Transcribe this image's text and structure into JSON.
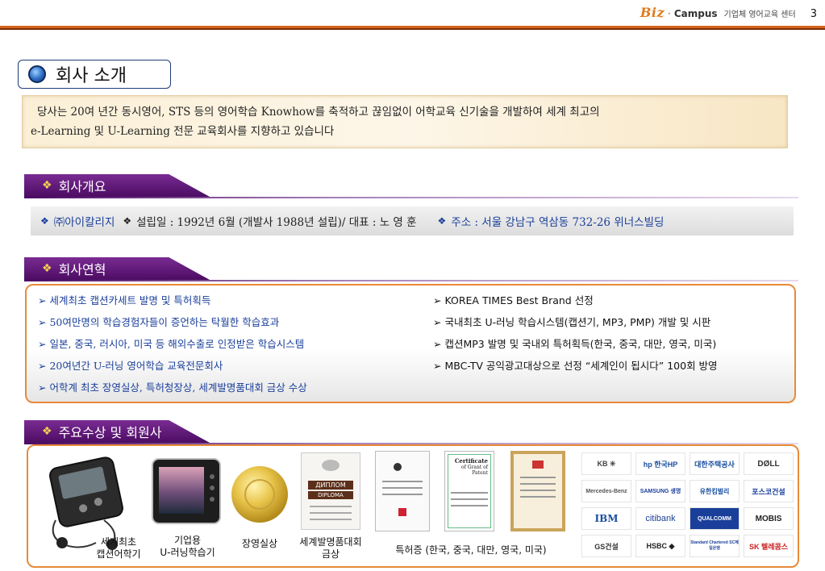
{
  "header": {
    "brand_biz": "Biz",
    "brand_dot": "·",
    "brand_campus": "Campus",
    "brand_sub": "기업체 영어교육 센터",
    "page_number": "3",
    "accent_color": "#d6621b"
  },
  "title": {
    "text": "회사 소개",
    "icon": "blue-orb-bullet-icon"
  },
  "intro": {
    "line1": "당사는 20여 년간 동시영어, STS 등의 영어학습 Knowhow를 축적하고  끊임없이 어학교육 신기술을 개발하여 세계 최고의",
    "line2": "e-Learning 및 U-Learning 전문 교육회사를 지향하고 있습니다"
  },
  "sections": {
    "overview_title": "회사개요",
    "history_title": "회사연혁",
    "awards_title": "주요수상 및 회원사",
    "bullet": "❖",
    "header_color": "#4c0c63"
  },
  "overview": {
    "company": "㈜아이칼리지",
    "established": "설립일 : 1992년 6월 (개발사 1988년 설립)/  대표 : 노 영 훈",
    "address": "주소 : 서울 강남구 역삼동 732-26 위너스빌딩"
  },
  "history": {
    "arrow": "➢",
    "left": [
      "세계최초 캡션카세트 발명 및 특허획득",
      "50여만명의 학습경험자들이 증언하는 탁월한 학습효과",
      "일본, 중국, 러시아, 미국 등 해외수출로 인정받은 학습시스템",
      "20여년간 U-러닝 영어학습 교육전문회사",
      "어학계 최초 장영실상, 특허청장상, 세계발명품대회 금상 수상"
    ],
    "right": [
      "KOREA TIMES Best Brand 선정",
      "국내최초  U-러닝 학습시스템(캡션기, MP3, PMP) 개발 및 시판",
      "캡션MP3 발명 및 국내외 특허획득(한국, 중국, 대만, 영국, 미국)",
      "MBC-TV 공익광고대상으로 선정 “세계인이 됩시다” 100회 방영"
    ]
  },
  "awards": {
    "labels": {
      "caption_device_line1": "세계최초",
      "caption_device_line2": "캡션어학기",
      "corporate_device_line1": "기업용",
      "corporate_device_line2": "U-러닝학습기",
      "jangyoungsil": "장영실상",
      "invention_line1": "세계발명품대회",
      "invention_line2": "금상",
      "patents": "특허증 (한국, 중국, 대만, 영국, 미국)"
    },
    "diploma_title": "ДИПЛОМ",
    "diploma_sub": "DIPLOMA",
    "patent_cert_title": "Certificate",
    "patent_cert_sub": "of Grant of Patent",
    "logos": [
      {
        "name": "KB",
        "text": "KB ✳"
      },
      {
        "name": "hp",
        "text": "hp 한국HP"
      },
      {
        "name": "daehan",
        "text": "대한주택공사"
      },
      {
        "name": "dell",
        "text": "DØLL"
      },
      {
        "name": "mercedes",
        "text": "Mercedes-Benz"
      },
      {
        "name": "samsung",
        "text": "SAMSUNG 생명"
      },
      {
        "name": "yuhan",
        "text": "유한킴벌리"
      },
      {
        "name": "posco",
        "text": "포스코건설"
      },
      {
        "name": "ibm",
        "text": "IBM"
      },
      {
        "name": "citibank",
        "text": "citibank"
      },
      {
        "name": "qualcomm",
        "text": "QUALCOMM"
      },
      {
        "name": "mobis",
        "text": "MOBIS"
      },
      {
        "name": "gs",
        "text": "GS건설"
      },
      {
        "name": "hsbc",
        "text": "HSBC ◆"
      },
      {
        "name": "standard",
        "text": "Standard Chartered SC제일은행"
      },
      {
        "name": "sk",
        "text": "SK 텔레콤스"
      }
    ]
  }
}
